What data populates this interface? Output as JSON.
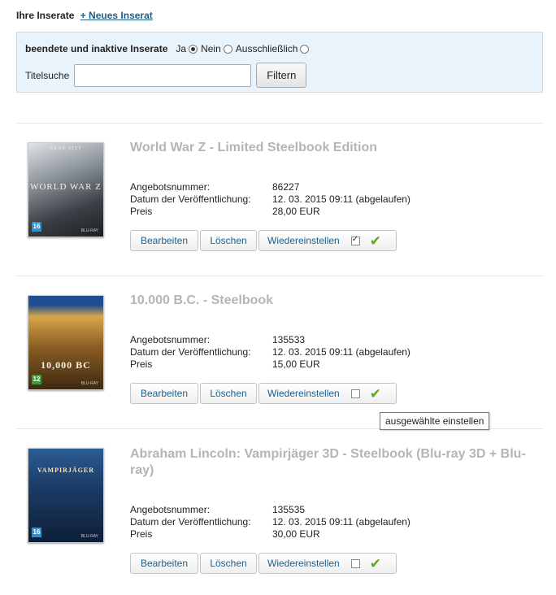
{
  "header": {
    "title": "Ihre Inserate",
    "new_link": "+ Neues Inserat"
  },
  "filter": {
    "inactive_label": "beendete und inaktive Inserate",
    "options": [
      "Ja",
      "Nein",
      "Ausschließlich"
    ],
    "selected_option": "Ja",
    "title_search_label": "Titelsuche",
    "title_search_value": "",
    "filter_button": "Filtern"
  },
  "labels": {
    "offer_number": "Angebotsnummer:",
    "published": "Datum der Veröffentlichung:",
    "price": "Preis",
    "edit": "Bearbeiten",
    "delete": "Löschen",
    "reinstate": "Wiedereinstellen"
  },
  "listings": [
    {
      "title": "World War Z - Limited Steelbook Edition",
      "offer_number": "86227",
      "published": "12. 03. 2015 09:11 (abgelaufen)",
      "price": "28,00 EUR",
      "selected": true,
      "cover_text": "WORLD WAR Z",
      "cover_top": "BRAD PITT",
      "cover_color": "#2a2e33",
      "age_rating": "16",
      "age_color": "#2f8fd0"
    },
    {
      "title": "10.000 B.C. - Steelbook",
      "offer_number": "135533",
      "published": "12. 03. 2015 09:11 (abgelaufen)",
      "price": "15,00 EUR",
      "selected": false,
      "cover_text": "10,000 BC",
      "cover_top": "",
      "cover_color": "#7a4e1d",
      "age_rating": "12",
      "age_color": "#3a9d3a"
    },
    {
      "title": "Abraham Lincoln: Vampirjäger 3D - Steelbook (Blu-ray 3D + Blu-ray)",
      "offer_number": "135535",
      "published": "12. 03. 2015 09:11 (abgelaufen)",
      "price": "30,00 EUR",
      "selected": false,
      "cover_text": "VAMPIRJÄGER",
      "cover_top": "",
      "cover_color": "#1d3f6b",
      "age_rating": "16",
      "age_color": "#2f8fd0"
    }
  ],
  "tooltip": "ausgewählte einstellen"
}
